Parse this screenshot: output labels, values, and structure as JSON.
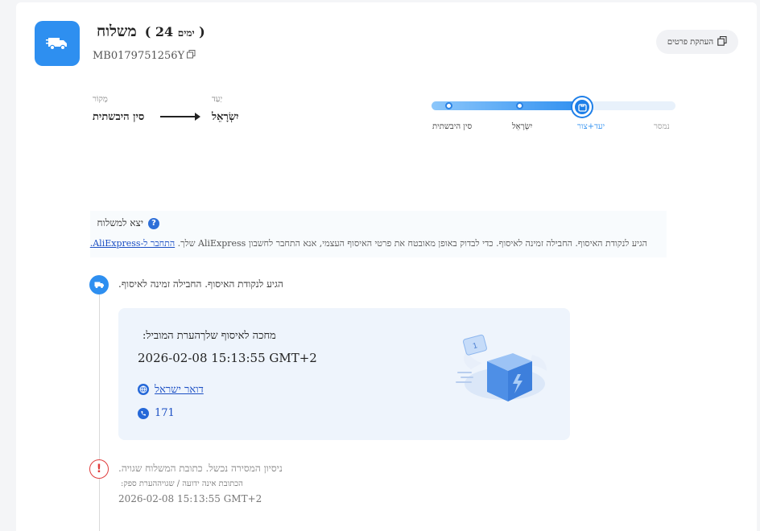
{
  "header": {
    "days_count": "24",
    "days_unit": "ימים",
    "title": "משלוח",
    "tracking_number": "MB0179751256Y",
    "copy_details_label": "העתקת פרטים"
  },
  "route": {
    "origin_label": "מָקוֹר",
    "origin_value": "סין היבשתית",
    "destination_label": "יַעַד",
    "destination_value": "יִשְׂרָאֵל"
  },
  "progress": {
    "fraction": 0.62,
    "steps": [
      {
        "label": "סין היבשתית",
        "state": "done"
      },
      {
        "label": "יִשְׂרָאֵל",
        "state": "done"
      },
      {
        "label": "יעד+צור",
        "state": "current"
      },
      {
        "label": "נמסר",
        "state": "pending"
      }
    ]
  },
  "notice": {
    "title": "יצא למשלוח",
    "body": "הגיע לנקודת האיסוף. החבילה זמינה לאיסוף. כדי לבדוק באופן מאובטח את פרטי האיסוף העצמי, אנא התחבר לחשבון AliExpress שלך.",
    "link": "התחבר ל-AliExpress."
  },
  "events": [
    {
      "text": "הגיע לנקודת האיסוף. החבילה זמינה לאיסוף.",
      "pickup": {
        "label": "מחכה לאיסוף שלךהערת המוביל:",
        "time": "2026-02-08 15:13:55 GMT+2",
        "carrier": "דואר ישראל",
        "phone": "171"
      }
    },
    {
      "text": "ניסיון המסירה נכשל. כתובת המשלוח שגויה.",
      "sub": "הכתובת אינה ידועה / שגויההערת ספק:",
      "time": "2026-02-08 15:13:55 GMT+2"
    }
  ],
  "colors": {
    "accent": "#2e8ff0",
    "error": "#e03c3c",
    "link": "#1b4fc4"
  }
}
